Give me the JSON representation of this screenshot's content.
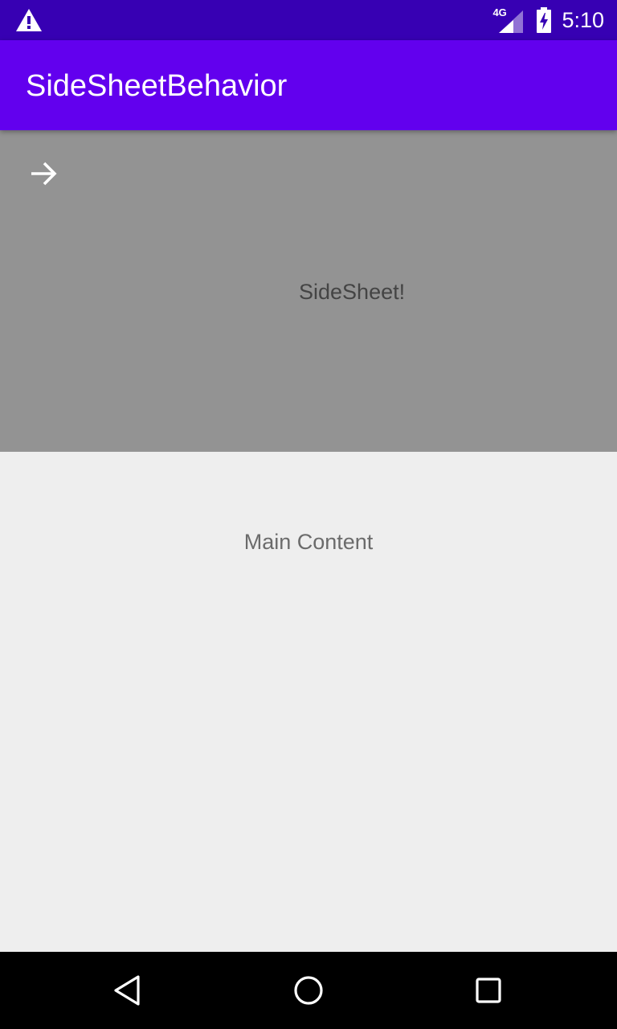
{
  "status_bar": {
    "network_type": "4G",
    "time": "5:10",
    "icons": [
      "warning-icon",
      "signal-icon",
      "battery-charging-icon"
    ],
    "colors": {
      "background": "#3700b3"
    }
  },
  "app_bar": {
    "title": "SideSheetBehavior",
    "colors": {
      "background": "#6200ee"
    }
  },
  "side_sheet": {
    "close_icon": "arrow-forward-icon",
    "text": "SideSheet!",
    "colors": {
      "background": "#939393",
      "text": "#444444"
    }
  },
  "main": {
    "text": "Main Content",
    "colors": {
      "background": "#eeeeee",
      "text": "#6b6b6b"
    }
  },
  "nav_bar": {
    "icons": [
      "back-icon",
      "home-icon",
      "recents-icon"
    ],
    "colors": {
      "background": "#000000"
    }
  }
}
